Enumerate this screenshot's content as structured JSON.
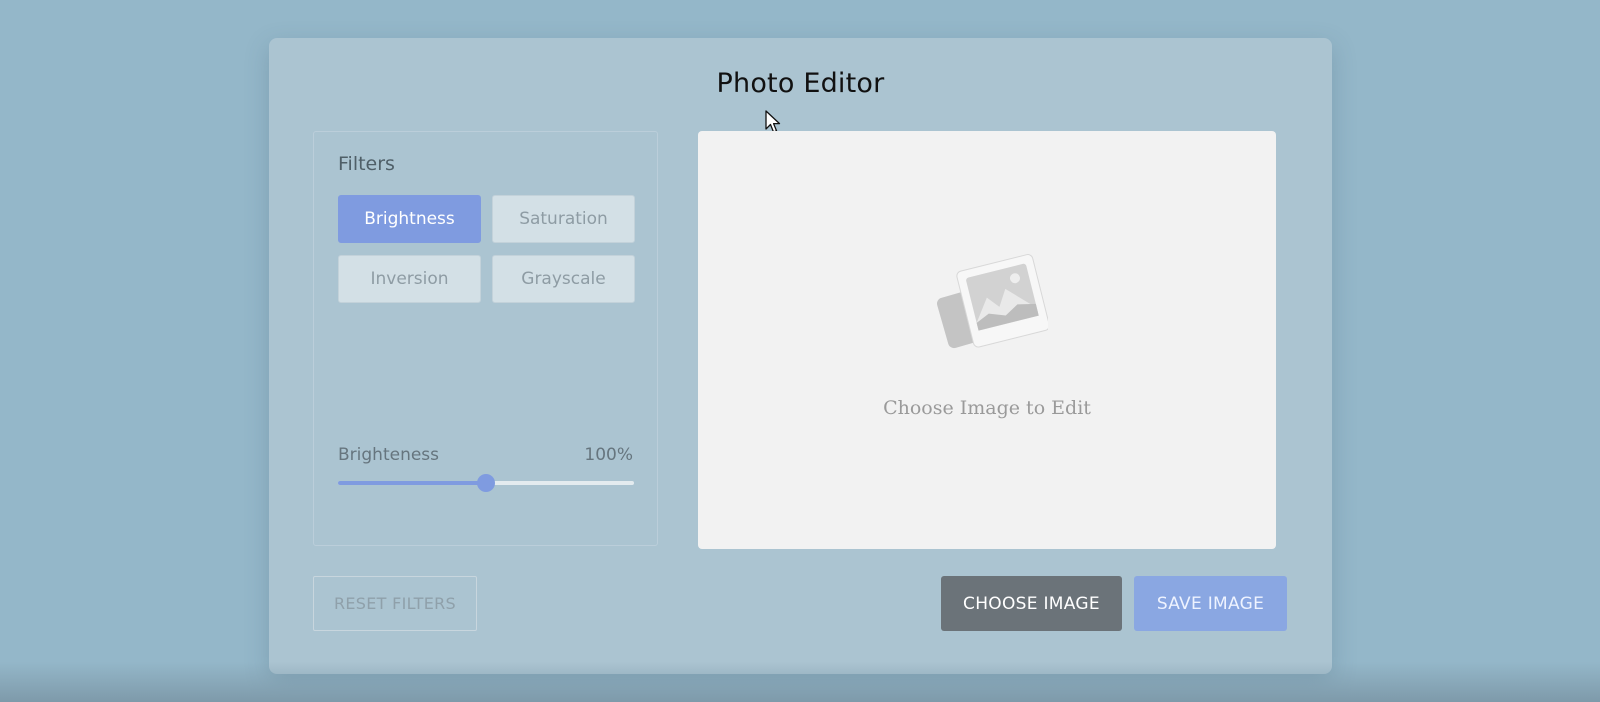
{
  "app": {
    "title": "Photo Editor"
  },
  "filters": {
    "heading": "Filters",
    "options": [
      {
        "label": "Brightness",
        "active": true
      },
      {
        "label": "Saturation",
        "active": false
      },
      {
        "label": "Inversion",
        "active": false
      },
      {
        "label": "Grayscale",
        "active": false
      }
    ]
  },
  "slider": {
    "label": "Brighteness",
    "value_text": "100%",
    "fraction": 0.5
  },
  "preview": {
    "placeholder_text": "Choose Image to Edit",
    "icon": "image-placeholder-icon"
  },
  "actions": {
    "reset_label": "RESET FILTERS",
    "choose_label": "CHOOSE IMAGE",
    "save_label": "SAVE IMAGE"
  },
  "colors": {
    "background": "#94b7c9",
    "card": "#abc4d1",
    "accent": "#7f9be0",
    "choose_button": "#6b7379"
  }
}
